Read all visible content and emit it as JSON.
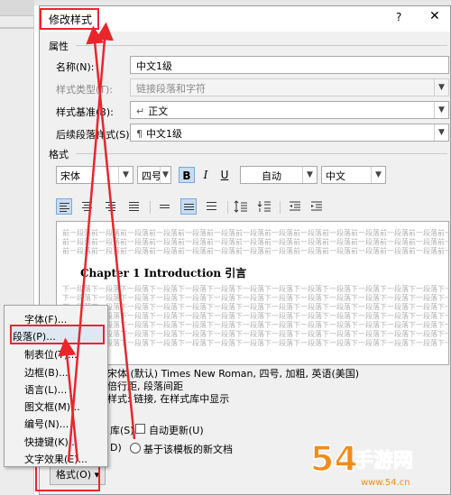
{
  "dialog": {
    "title": "修改样式",
    "help": "?",
    "close": "✕"
  },
  "properties": {
    "section": "属性",
    "name_label": "名称(N):",
    "name_value": "中文1级",
    "type_label": "样式类型(T):",
    "type_value": "链接段落和字符",
    "based_label": "样式基准(B):",
    "based_value": "正文",
    "next_label": "后续段落样式(S):",
    "next_value": "中文1级"
  },
  "format": {
    "section": "格式",
    "font": "宋体",
    "size": "四号",
    "bold": "B",
    "italic": "I",
    "underline": "U",
    "color": "自动",
    "lang": "中文"
  },
  "preview": {
    "prev_text": "前一段落前一段落前一段落前一段落前一段落前一段落前一段落前一段落前一段落前一段落前一段落前一段落前一段落前一段落前一段落前一段落",
    "sample": "Chapter 1 Introduction 引言",
    "next_text": "下一段落下一段落下一段落下一段落下一段落下一段落下一段落下一段落下一段落下一段落下一段落下一段落下一段落下一段落下一段落下一段落"
  },
  "description": {
    "line1": "宋体 (默认) Times New Roman, 四号, 加粗, 英语(美国)",
    "line2": "倍行距, 段落间距",
    "line3": "样式: 链接, 在样式库中显示"
  },
  "options": {
    "add_to_gallery": "库(S)",
    "auto_update": "自动更新(U)",
    "only_doc": "D)",
    "template_docs": "基于该模板的新文档"
  },
  "format_button": "格式(O)",
  "menu": {
    "items": [
      "字体(F)...",
      "段落(P)...",
      "制表位(T)...",
      "边框(B)...",
      "语言(L)...",
      "图文框(M)...",
      "编号(N)...",
      "快捷键(K)...",
      "文字效果(E)..."
    ]
  },
  "watermark": {
    "text": "54手游网",
    "url": "www.54.cn"
  },
  "colors": {
    "highlight": "#e8262c",
    "accent": "#c8dcf0"
  }
}
